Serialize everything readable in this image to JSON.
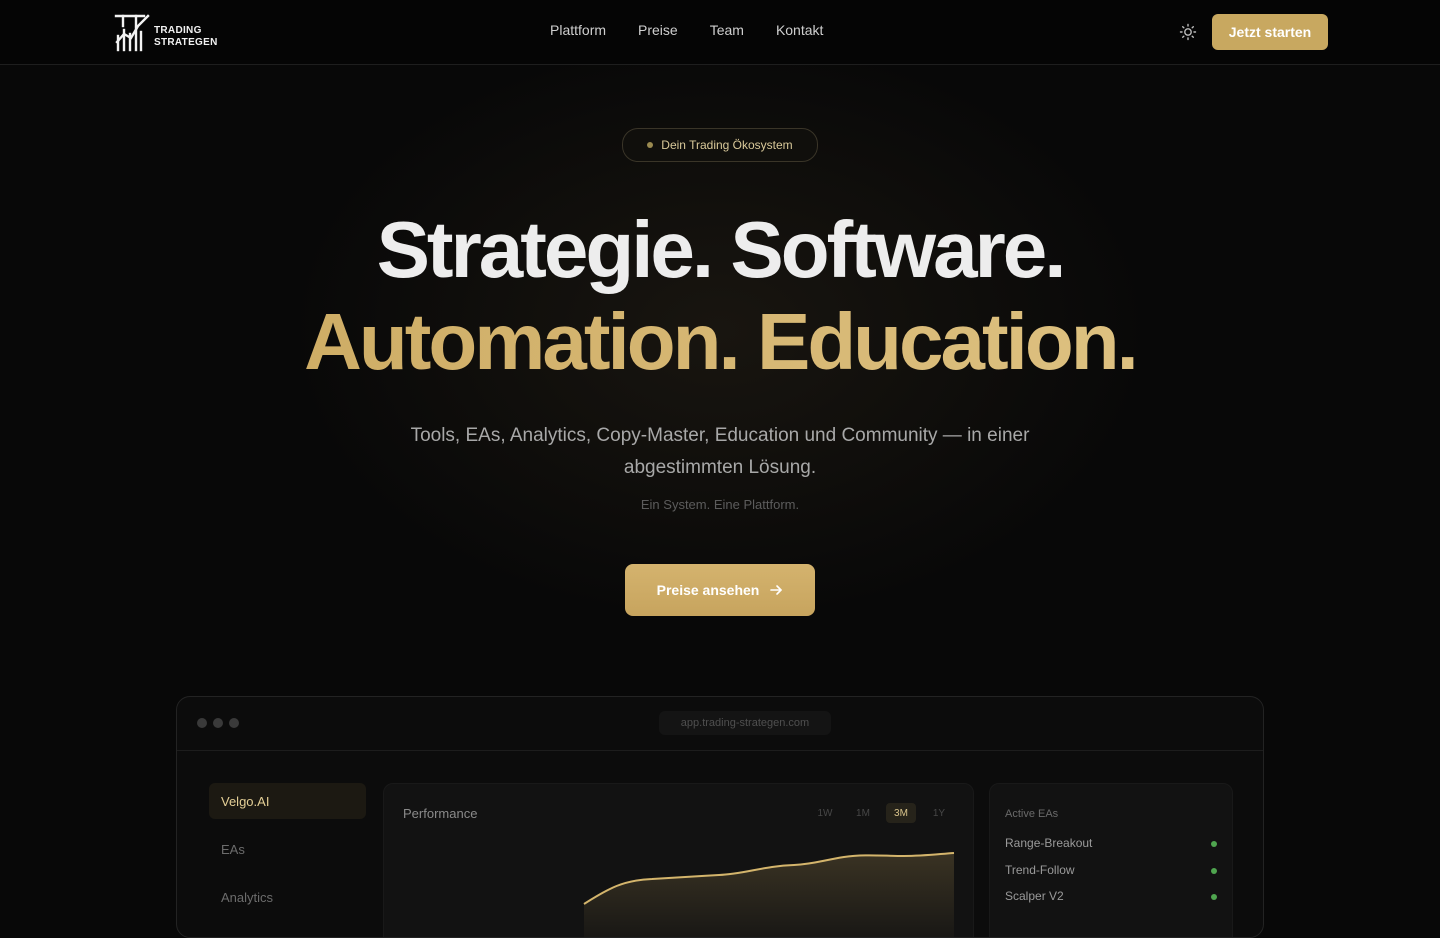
{
  "header": {
    "logo_line1": "TRADING",
    "logo_line2": "STRATEGEN",
    "nav": [
      "Plattform",
      "Preise",
      "Team",
      "Kontakt"
    ],
    "cta": "Jetzt starten"
  },
  "hero": {
    "badge": "Dein Trading Ökosystem",
    "headline_line1": "Strategie. Software.",
    "headline_line2": "Automation. Education.",
    "subtitle": "Tools, EAs, Analytics, Copy-Master, Education und Community — in einer abgestimmten Lösung.",
    "tagline": "Ein System. Eine Plattform.",
    "cta": "Preise ansehen"
  },
  "app_preview": {
    "url": "app.trading-strategen.com",
    "sidebar": [
      {
        "label": "Velgo.AI",
        "active": true
      },
      {
        "label": "EAs",
        "active": false
      },
      {
        "label": "Analytics",
        "active": false
      }
    ],
    "performance": {
      "title": "Performance",
      "ranges": [
        "1W",
        "1M",
        "3M",
        "1Y"
      ],
      "active_range": "3M"
    },
    "active_eas": {
      "title": "Active EAs",
      "items": [
        "Range-Breakout",
        "Trend-Follow",
        "Scalper V2"
      ]
    }
  },
  "colors": {
    "accent": "#c8a860",
    "background": "#080808",
    "status_active": "#4fa54f"
  }
}
